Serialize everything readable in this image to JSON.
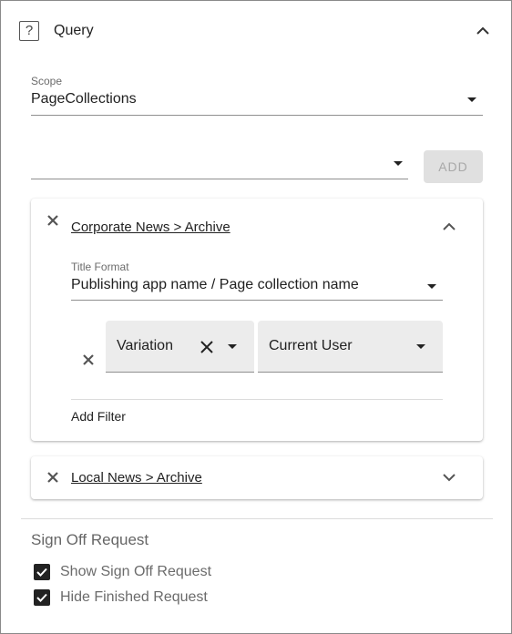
{
  "header": {
    "title": "Query",
    "help_icon_char": "?"
  },
  "scope": {
    "label": "Scope",
    "value": "PageCollections"
  },
  "add_row": {
    "select_value": "",
    "add_label": "ADD"
  },
  "panels": [
    {
      "link": "Corporate News > Archive",
      "expanded": true,
      "title_format": {
        "label": "Title Format",
        "value": "Publishing app name / Page collection name"
      },
      "filter": {
        "field": "Variation",
        "operator_value": "Current User"
      },
      "add_filter_label": "Add Filter"
    },
    {
      "link": "Local News > Archive",
      "expanded": false
    }
  ],
  "sign_off": {
    "heading": "Sign Off Request",
    "options": [
      {
        "label": "Show Sign Off Request",
        "checked": true
      },
      {
        "label": "Hide Finished Request",
        "checked": true
      }
    ]
  }
}
